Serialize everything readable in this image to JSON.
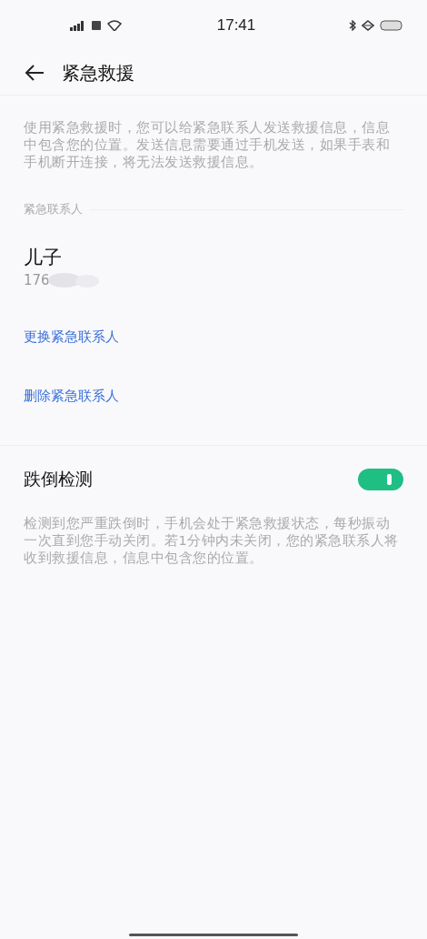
{
  "status_bar": {
    "time": "17:41"
  },
  "header": {
    "title": "紧急救援"
  },
  "intro": "使用紧急救援时，您可以给紧急联系人发送救援信息，信息中包含您的位置。发送信息需要通过手机发送，如果手表和手机断开连接，将无法发送救援信息。",
  "contacts_section": {
    "label": "紧急联系人",
    "contact": {
      "name": "儿子",
      "phone": "176"
    },
    "actions": [
      "更换紧急联系人",
      "删除紧急联系人"
    ]
  },
  "fall_detection": {
    "title": "跌倒检测",
    "on": true,
    "description": "检测到您严重跌倒时，手机会处于紧急救援状态，每秒振动一次直到您手动关闭。若1分钟内未关闭，您的紧急联系人将收到救援信息，信息中包含您的位置。"
  }
}
